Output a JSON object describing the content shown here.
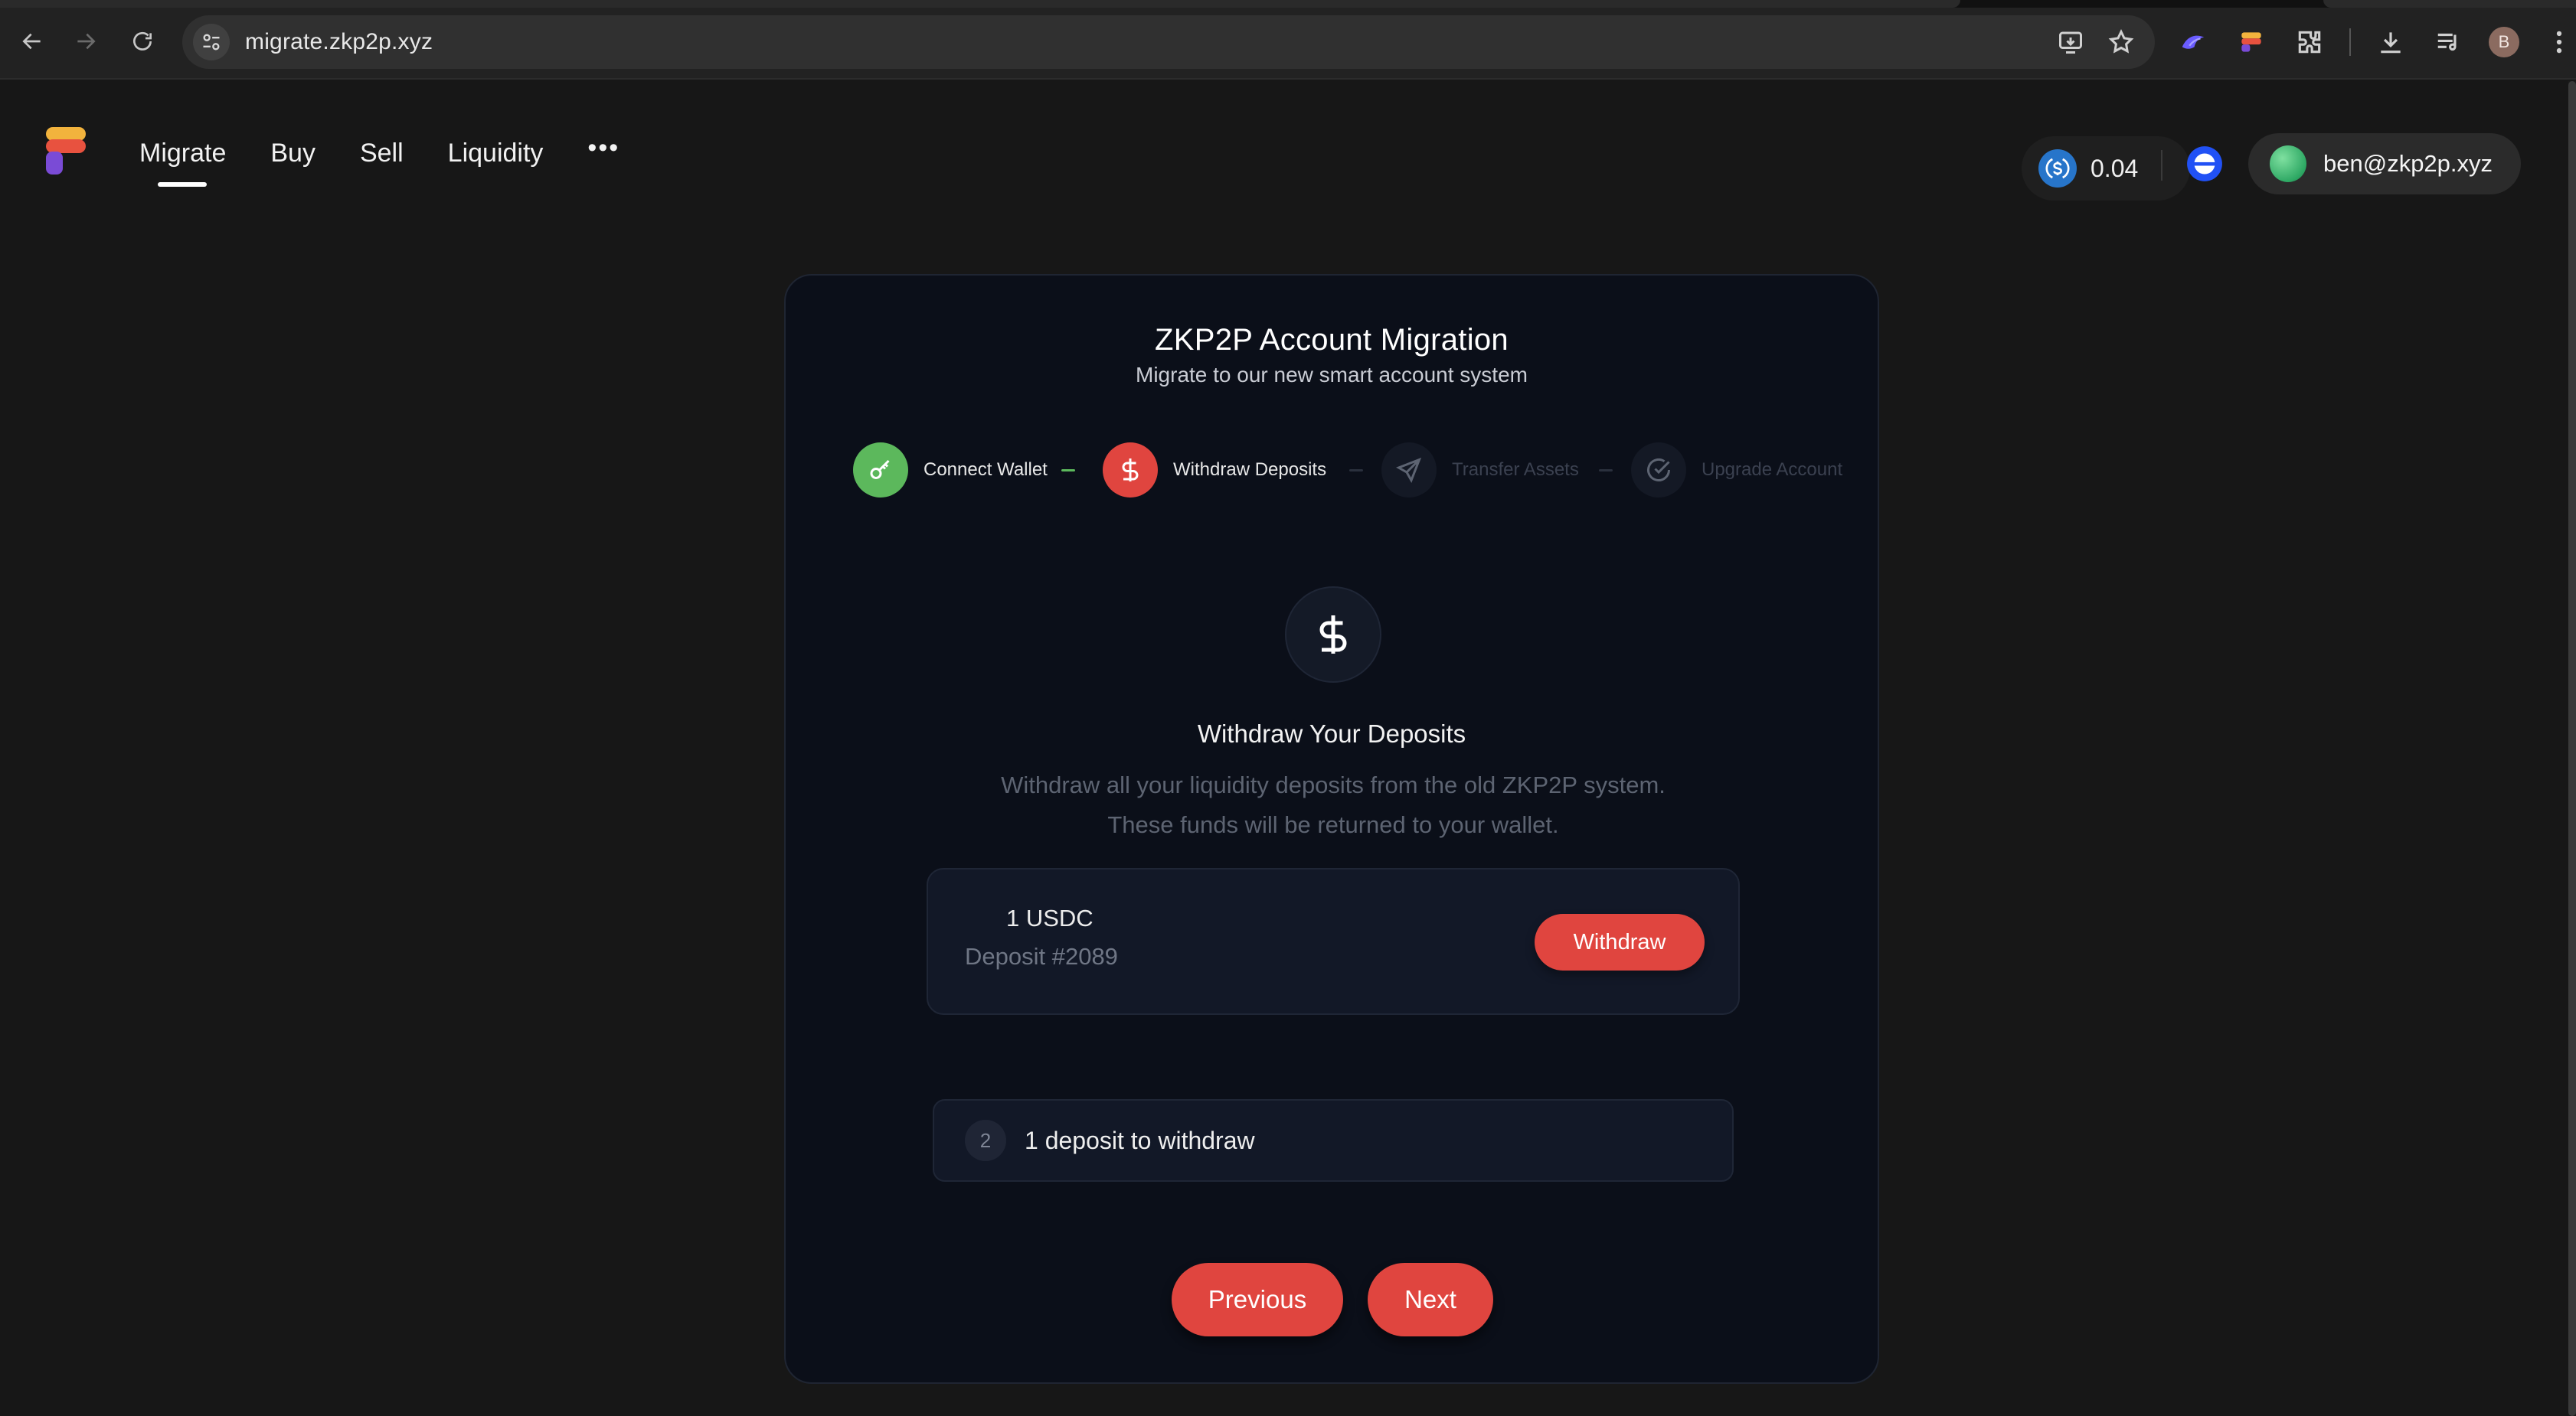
{
  "browser": {
    "url": "migrate.zkp2p.xyz",
    "profile_initial": "B"
  },
  "header": {
    "nav": [
      {
        "label": "Migrate",
        "active": true
      },
      {
        "label": "Buy",
        "active": false
      },
      {
        "label": "Sell",
        "active": false
      },
      {
        "label": "Liquidity",
        "active": false
      }
    ],
    "more": "•••",
    "balance": "0.04",
    "account": "ben@zkp2p.xyz"
  },
  "card": {
    "title": "ZKP2P Account Migration",
    "subtitle": "Migrate to our new smart account system",
    "steps": [
      {
        "label": "Connect Wallet",
        "state": "done",
        "color": "#5cb85c",
        "icon": "key-icon"
      },
      {
        "label": "Withdraw Deposits",
        "state": "current",
        "color": "#e0453f",
        "icon": "dollar-icon"
      },
      {
        "label": "Transfer Assets",
        "state": "upcoming",
        "color": "#141925",
        "icon": "send-icon"
      },
      {
        "label": "Upgrade Account",
        "state": "upcoming",
        "color": "#141925",
        "icon": "check-circle-icon"
      }
    ],
    "section": {
      "title": "Withdraw Your Deposits",
      "description": "Withdraw all your liquidity deposits from the old ZKP2P system. These funds will be returned to your wallet."
    },
    "deposit": {
      "amount": "1 USDC",
      "id": "Deposit #2089",
      "button": "Withdraw"
    },
    "summary": {
      "number": "2",
      "text": "1 deposit to withdraw"
    },
    "buttons": {
      "previous": "Previous",
      "next": "Next"
    }
  },
  "colors": {
    "accent": "#e0453f",
    "success": "#5cb85c",
    "card_bg": "#0b0f19",
    "page_bg": "#171717"
  }
}
